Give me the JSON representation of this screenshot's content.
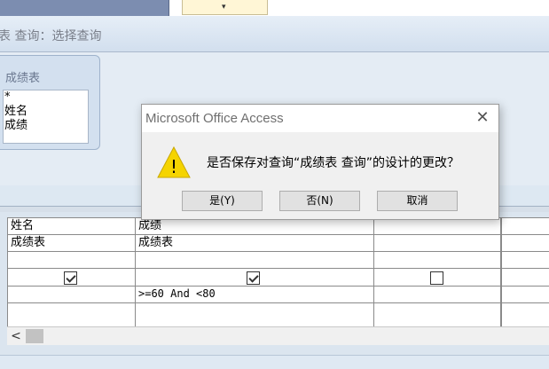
{
  "window": {
    "title": "表 查询：选择查询"
  },
  "top_mark": "▾",
  "table_box": {
    "title": "成绩表",
    "fields": [
      "*",
      "姓名",
      "成绩"
    ]
  },
  "grid": {
    "rows": [
      [
        "姓名",
        "成绩",
        "",
        ""
      ],
      [
        "成绩表",
        "成绩表",
        "",
        ""
      ],
      [
        "",
        "",
        "",
        ""
      ],
      [
        "",
        "",
        "",
        ""
      ],
      [
        "",
        ">=60 And <80",
        "",
        ""
      ],
      [
        "",
        "",
        "",
        ""
      ]
    ],
    "show_checkboxes": [
      true,
      true,
      false
    ]
  },
  "scrollbar": {
    "left_arrow": "<"
  },
  "dialog": {
    "title": "Microsoft Office Access",
    "close_glyph": "✕",
    "message": "是否保存对查询“成绩表 查询”的设计的更改？",
    "buttons": {
      "yes": "是(Y)",
      "no": "否(N)",
      "cancel": "取消"
    },
    "icon": "warning-icon",
    "icon_glyph": "!",
    "icon_color": "#f5d400"
  }
}
